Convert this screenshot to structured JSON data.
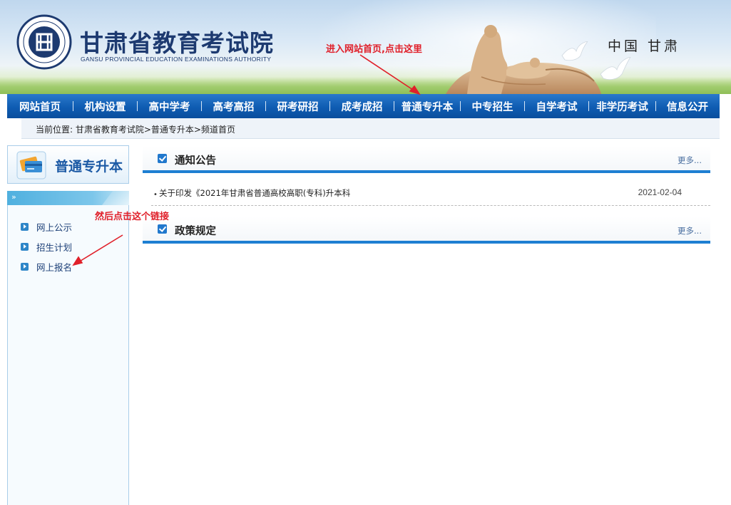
{
  "header": {
    "title": "甘肃省教育考试院",
    "subtitle": "GANSU PROVINCIAL EDUCATION EXAMINATIONS AUTHORITY",
    "region": "中国  甘肃",
    "logo_char": "甘"
  },
  "nav": {
    "items": [
      {
        "label": "网站首页"
      },
      {
        "label": "机构设置"
      },
      {
        "label": "高中学考"
      },
      {
        "label": "高考高招"
      },
      {
        "label": "研考研招"
      },
      {
        "label": "成考成招"
      },
      {
        "label": "普通专升本"
      },
      {
        "label": "中专招生"
      },
      {
        "label": "自学考试"
      },
      {
        "label": "非学历考试"
      },
      {
        "label": "信息公开"
      }
    ]
  },
  "breadcrumb": {
    "prefix": "当前位置:",
    "path": "甘肃省教育考试院>普通专升本>频道首页"
  },
  "sidebar": {
    "title": "普通专升本",
    "strip_glyph": "»",
    "links": [
      {
        "label": "网上公示"
      },
      {
        "label": "招生计划"
      },
      {
        "label": "网上报名"
      }
    ]
  },
  "sections": [
    {
      "title": "通知公告",
      "more": "更多...",
      "items": [
        {
          "bullet": "•",
          "title": "关于印发《2021年甘肃省普通高校高职(专科)升本科",
          "date": "2021-02-04"
        }
      ]
    },
    {
      "title": "政策规定",
      "more": "更多..."
    }
  ],
  "annotations": {
    "top": "进入网站首页,点击这里",
    "side": "然后点击这个链接",
    "color": "#e0202a"
  },
  "colors": {
    "nav": "#0f5cb2",
    "accent": "#1e7fd2",
    "title": "#1d3a70"
  }
}
